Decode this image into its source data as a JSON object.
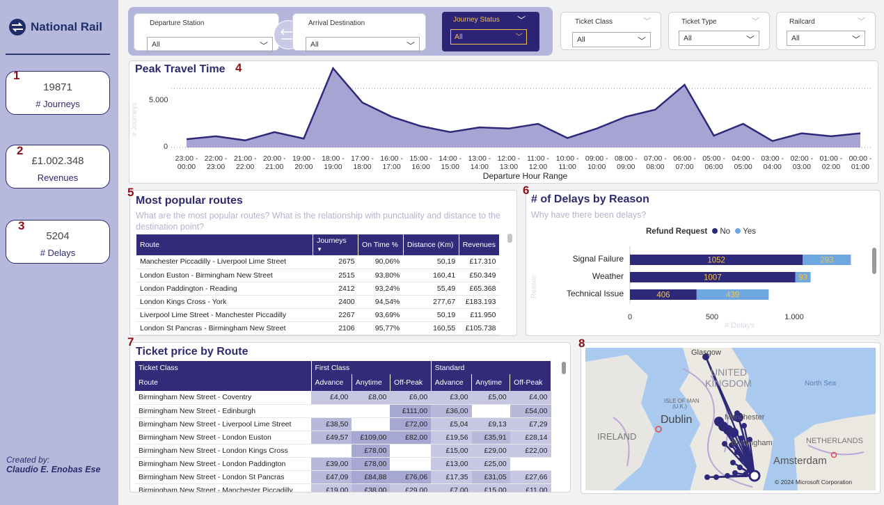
{
  "brand": {
    "logo_text": "National Rail"
  },
  "kpis": [
    {
      "marker": "1",
      "value": "19871",
      "label": "# Journeys"
    },
    {
      "marker": "2",
      "value": "£1.002.348",
      "label": "Revenues"
    },
    {
      "marker": "3",
      "value": "5204",
      "label": "# Delays"
    }
  ],
  "credit": {
    "line1": "Created by:",
    "line2": "Claudio E. Enobas Ese"
  },
  "filters": [
    {
      "title": "Departure Station",
      "value": "All"
    },
    {
      "title": "Arrival Destination",
      "value": "All"
    },
    {
      "title": "Journey Status",
      "value": "All"
    },
    {
      "title": "Ticket Class",
      "value": "All"
    },
    {
      "title": "Ticket Type",
      "value": "All"
    },
    {
      "title": "Railcard",
      "value": "All"
    }
  ],
  "markers": {
    "m4": "4",
    "m5": "5",
    "m6": "6",
    "m7": "7",
    "m8": "8"
  },
  "peak": {
    "title": "Peak Travel Time",
    "ylabel": "# Journeys",
    "xlabel": "Departure Hour Range",
    "yticks": [
      "5.000",
      "0"
    ],
    "chart_data": {
      "type": "area",
      "x": [
        "23:00 - 00:00",
        "22:00 - 23:00",
        "21:00 - 22:00",
        "20:00 - 21:00",
        "19:00 - 20:00",
        "18:00 - 19:00",
        "17:00 - 18:00",
        "16:00 - 17:00",
        "15:00 - 16:00",
        "14:00 - 15:00",
        "13:00 - 14:00",
        "12:00 - 13:00",
        "11:00 - 12:00",
        "10:00 - 11:00",
        "09:00 - 10:00",
        "08:00 - 09:00",
        "07:00 - 08:00",
        "06:00 - 07:00",
        "05:00 - 06:00",
        "04:00 - 05:00",
        "03:00 - 04:00",
        "02:00 - 03:00",
        "01:00 - 02:00",
        "00:00 - 01:00"
      ],
      "values": [
        700,
        950,
        600,
        1300,
        750,
        6700,
        3800,
        2600,
        1800,
        1300,
        1700,
        1600,
        2000,
        800,
        1600,
        2600,
        3200,
        5300,
        1000,
        2000,
        550,
        1200,
        950,
        1200
      ],
      "ylim": [
        0,
        7000
      ]
    }
  },
  "routes": {
    "title": "Most popular routes",
    "subtitle": "What are the most popular routes? What is the relationship with punctuality and distance to the destination point?",
    "columns": [
      "Route",
      "Journeys",
      "On Time %",
      "Distance (Km)",
      "Revenues"
    ],
    "rows": [
      [
        "Manchester Piccadilly - Liverpool Lime Street",
        "2675",
        "90,06%",
        "50,19",
        "£17.310"
      ],
      [
        "London Euston - Birmingham New Street",
        "2515",
        "93,80%",
        "160,41",
        "£50.349"
      ],
      [
        "London Paddington - Reading",
        "2412",
        "93,24%",
        "55,49",
        "£65.368"
      ],
      [
        "London Kings Cross - York",
        "2400",
        "94,54%",
        "277,67",
        "£183.193"
      ],
      [
        "Liverpool Lime Street - Manchester Piccadilly",
        "2267",
        "93,69%",
        "50,19",
        "£11.950"
      ],
      [
        "London St Pancras - Birmingham New Street",
        "2106",
        "95,77%",
        "160,55",
        "£105.738"
      ]
    ]
  },
  "delays": {
    "title": "# of Delays by Reason",
    "subtitle": "Why have there been delays?",
    "legend_title": "Refund Request",
    "legend": [
      "No",
      "Yes"
    ],
    "ylabel": "Reason",
    "xlabel": "# Delays",
    "xticks": [
      "0",
      "500",
      "1.000"
    ],
    "chart_data": {
      "type": "bar",
      "orientation": "horizontal",
      "stacked": true,
      "categories": [
        "Signal Failure",
        "Weather",
        "Technical Issue"
      ],
      "series": [
        {
          "name": "No",
          "values": [
            1052,
            1007,
            406
          ]
        },
        {
          "name": "Yes",
          "values": [
            293,
            93,
            439
          ]
        }
      ],
      "xlim": [
        0,
        1400
      ]
    },
    "colors": {
      "no": "#2e2878",
      "yes": "#6fa8e0",
      "label": "#f2c14e"
    }
  },
  "prices": {
    "title": "Ticket price by Route",
    "group_label": "Ticket Class",
    "route_label": "Route",
    "classes": [
      "First Class",
      "Standard"
    ],
    "types": [
      "Advance",
      "Anytime",
      "Off-Peak",
      "Advance",
      "Anytime",
      "Off-Peak"
    ],
    "rows": [
      [
        "Birmingham New Street - Coventry",
        "£4,00",
        "£8,00",
        "£6,00",
        "£3,00",
        "£5,00",
        "£4,00"
      ],
      [
        "Birmingham New Street - Edinburgh",
        "",
        "",
        "£111,00",
        "£36,00",
        "",
        "£54,00"
      ],
      [
        "Birmingham New Street - Liverpool Lime Street",
        "£38,50",
        "",
        "£72,00",
        "£5,04",
        "£9,13",
        "£7,29"
      ],
      [
        "Birmingham New Street - London Euston",
        "£49,57",
        "£109,00",
        "£82,00",
        "£19,56",
        "£35,91",
        "£28,14"
      ],
      [
        "Birmingham New Street - London Kings Cross",
        "",
        "£78,00",
        "",
        "£15,00",
        "£29,00",
        "£22,00"
      ],
      [
        "Birmingham New Street - London Paddington",
        "£39,00",
        "£78,00",
        "",
        "£13,00",
        "£25,00",
        ""
      ],
      [
        "Birmingham New Street - London St Pancras",
        "£47,09",
        "£84,88",
        "£76,06",
        "£17,35",
        "£31,05",
        "£27,66"
      ],
      [
        "Birmingham New Street - Manchester Piccadilly",
        "£19,00",
        "£38,00",
        "£29,00",
        "£7,00",
        "£15,00",
        "£11,00"
      ]
    ]
  },
  "map": {
    "labels": [
      "Glasgow",
      "UNITED",
      "KINGDOM",
      "North Sea",
      "ISLE OF MAN",
      "(U.K.)",
      "Dublin",
      "Manchester",
      "IRELAND",
      "Birmingham",
      "NETHERLANDS",
      "Amsterdam"
    ],
    "copyright": "© 2024 Microsoft Corporation"
  }
}
